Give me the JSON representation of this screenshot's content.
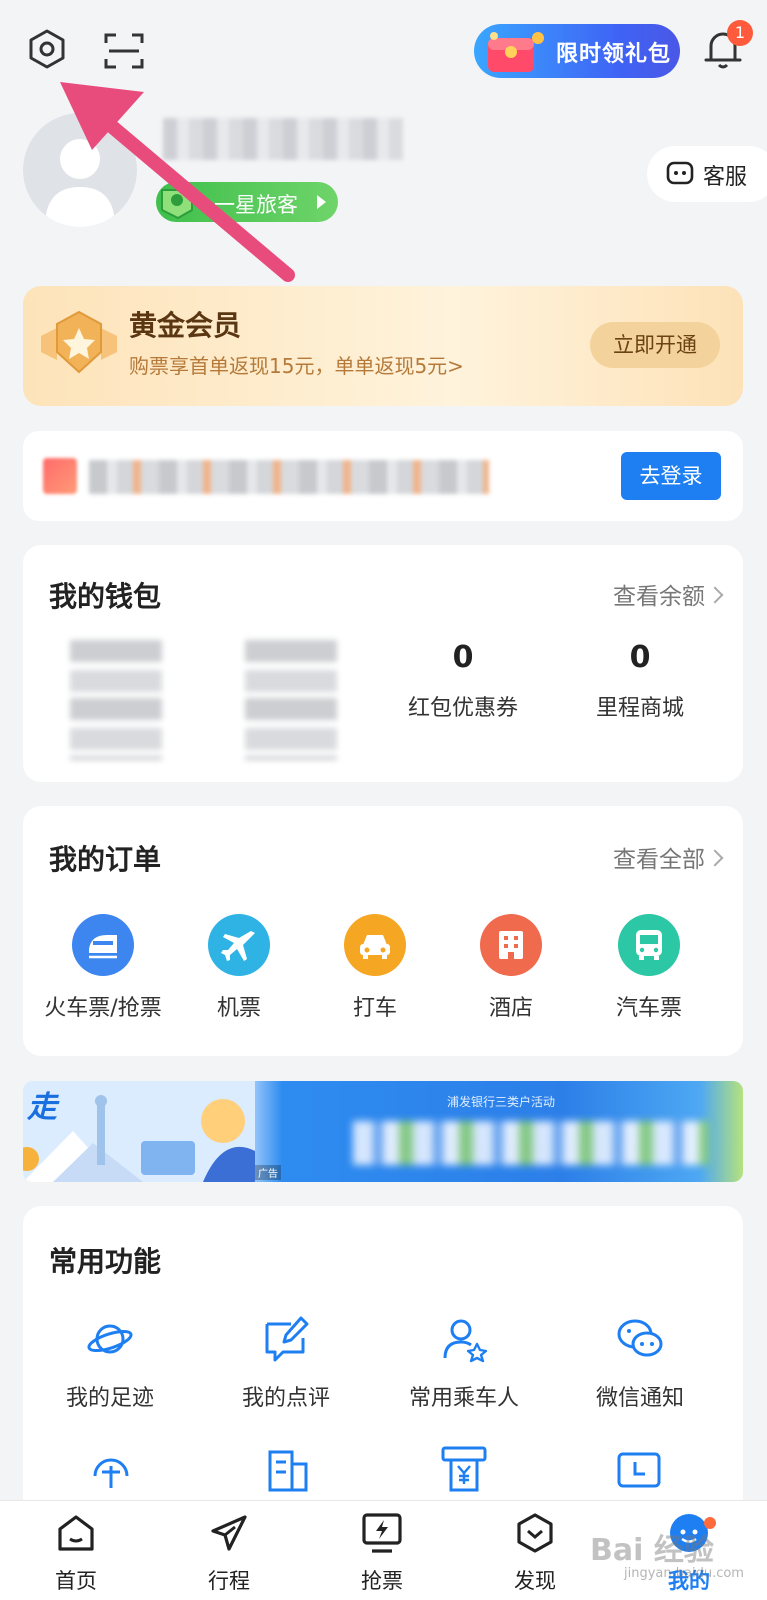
{
  "header": {
    "gift_label": "限时领礼包",
    "notification_count": "1"
  },
  "profile": {
    "level": "一星旅客",
    "service_label": "客服"
  },
  "gold_member": {
    "title": "黄金会员",
    "subtitle": "购票享首单返现15元，单单返现5元>",
    "button": "立即开通"
  },
  "login_bar": {
    "button": "去登录"
  },
  "wallet": {
    "title": "我的钱包",
    "link": "查看余额",
    "items": [
      {
        "value": "0",
        "label": "红包优惠券"
      },
      {
        "value": "0",
        "label": "里程商城"
      }
    ]
  },
  "orders": {
    "title": "我的订单",
    "link": "查看全部",
    "items": [
      {
        "label": "火车票/抢票",
        "icon": "train-icon",
        "color": "#3d86f0"
      },
      {
        "label": "机票",
        "icon": "plane-icon",
        "color": "#2fb3e5"
      },
      {
        "label": "打车",
        "icon": "car-icon",
        "color": "#f5a623"
      },
      {
        "label": "酒店",
        "icon": "hotel-icon",
        "color": "#f06a4e"
      },
      {
        "label": "汽车票",
        "icon": "bus-icon",
        "color": "#2cc7a5"
      }
    ]
  },
  "banner": {
    "ad_tag": "广告",
    "caption": "浦发银行三类户活动"
  },
  "common_functions": {
    "title": "常用功能",
    "items": [
      {
        "label": "我的足迹",
        "icon": "planet-icon"
      },
      {
        "label": "我的点评",
        "icon": "edit-comment-icon"
      },
      {
        "label": "常用乘车人",
        "icon": "passenger-icon"
      },
      {
        "label": "微信通知",
        "icon": "wechat-icon"
      }
    ]
  },
  "tabbar": {
    "items": [
      {
        "label": "首页",
        "icon": "home-icon"
      },
      {
        "label": "行程",
        "icon": "trip-icon"
      },
      {
        "label": "抢票",
        "icon": "grab-ticket-icon"
      },
      {
        "label": "发现",
        "icon": "discover-icon"
      },
      {
        "label": "我的",
        "icon": "me-icon"
      }
    ],
    "active_index": 4
  },
  "watermark": {
    "main": "Bai 经验",
    "sub": "jingyan.baidu.com"
  }
}
